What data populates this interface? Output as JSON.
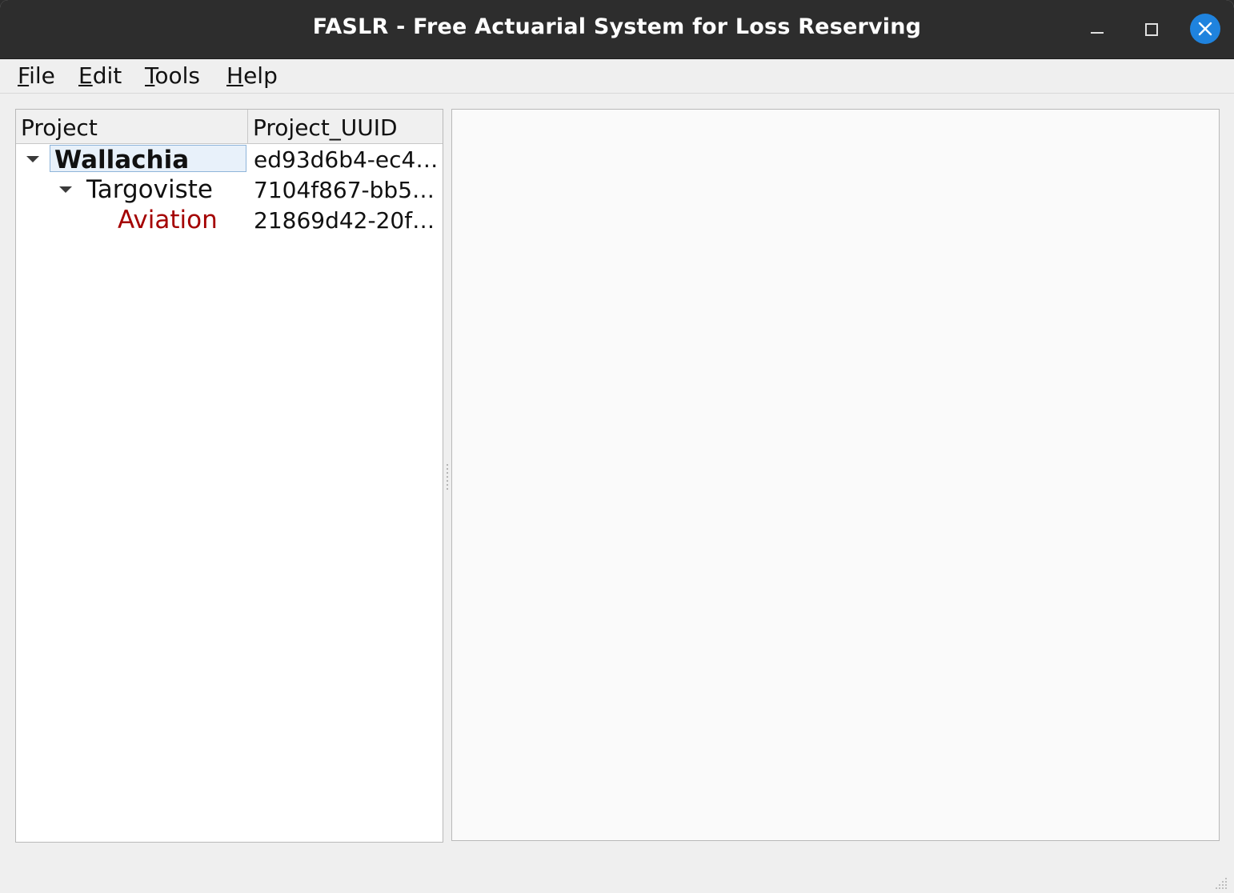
{
  "window": {
    "title": "FASLR - Free Actuarial System for Loss Reserving"
  },
  "menu": {
    "items": [
      {
        "mnemonic": "F",
        "rest": "ile"
      },
      {
        "mnemonic": "E",
        "rest": "dit"
      },
      {
        "mnemonic": "T",
        "rest": "ools"
      },
      {
        "mnemonic": "H",
        "rest": "elp"
      }
    ]
  },
  "tree": {
    "headers": {
      "project": "Project",
      "uuid": "Project_UUID"
    },
    "rows": [
      {
        "name": "Wallachia",
        "uuid": "ed93d6b4-ec4…",
        "expanded": true,
        "selected": true
      },
      {
        "name": "Targoviste",
        "uuid": "7104f867-bb5…",
        "expanded": true
      },
      {
        "name": "Aviation",
        "uuid": "21869d42-20f…"
      }
    ]
  },
  "colors": {
    "titlebar": "#2d2d2d",
    "close_button": "#1f83de",
    "leaf_text": "#a40000",
    "selection": "#e8f1fa"
  },
  "icons": [
    "minimize-icon",
    "maximize-icon",
    "close-icon",
    "expand-arrow-icon",
    "resize-grip-icon"
  ]
}
